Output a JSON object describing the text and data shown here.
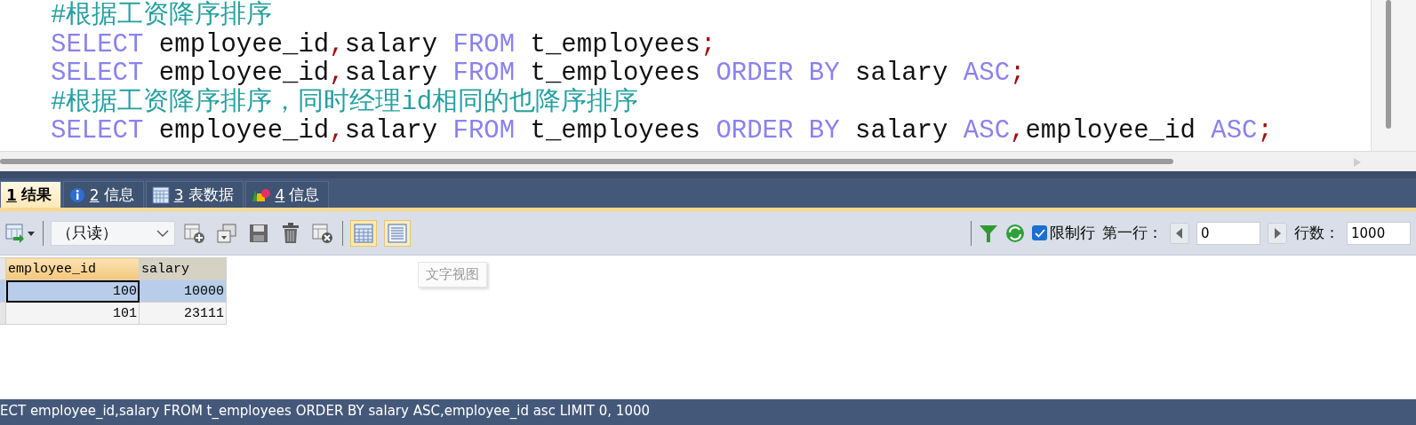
{
  "editor": {
    "lines": [
      [
        {
          "kind": "comment",
          "text": "#根据工资降序排序"
        }
      ],
      [
        {
          "kind": "keyword",
          "text": "SELECT"
        },
        {
          "kind": "plain",
          "text": " employee_id"
        },
        {
          "kind": "punct",
          "text": ","
        },
        {
          "kind": "plain",
          "text": "salary "
        },
        {
          "kind": "keyword",
          "text": "FROM"
        },
        {
          "kind": "plain",
          "text": " t_employees"
        },
        {
          "kind": "punct",
          "text": ";"
        }
      ],
      [
        {
          "kind": "keyword",
          "text": "SELECT"
        },
        {
          "kind": "plain",
          "text": " employee_id"
        },
        {
          "kind": "punct",
          "text": ","
        },
        {
          "kind": "plain",
          "text": "salary "
        },
        {
          "kind": "keyword",
          "text": "FROM"
        },
        {
          "kind": "plain",
          "text": " t_employees "
        },
        {
          "kind": "keyword",
          "text": "ORDER BY"
        },
        {
          "kind": "plain",
          "text": " salary "
        },
        {
          "kind": "keyword",
          "text": "ASC"
        },
        {
          "kind": "punct",
          "text": ";"
        }
      ],
      [
        {
          "kind": "comment",
          "text": "#根据工资降序排序，同时经理id相同的也降序排序"
        }
      ],
      [
        {
          "kind": "keyword",
          "text": "SELECT"
        },
        {
          "kind": "plain",
          "text": " employee_id"
        },
        {
          "kind": "punct",
          "text": ","
        },
        {
          "kind": "plain",
          "text": "salary "
        },
        {
          "kind": "keyword",
          "text": "FROM"
        },
        {
          "kind": "plain",
          "text": " t_employees "
        },
        {
          "kind": "keyword",
          "text": "ORDER BY"
        },
        {
          "kind": "plain",
          "text": " salary "
        },
        {
          "kind": "keyword",
          "text": "ASC"
        },
        {
          "kind": "punct",
          "text": ","
        },
        {
          "kind": "plain",
          "text": "employee_id "
        },
        {
          "kind": "keyword",
          "text": "ASC"
        },
        {
          "kind": "punct",
          "text": ";"
        }
      ]
    ]
  },
  "tabs": [
    {
      "number": "1",
      "label": "结果",
      "selected": true
    },
    {
      "number": "2",
      "label": "信息",
      "selected": false
    },
    {
      "number": "3",
      "label": "表数据",
      "selected": false
    },
    {
      "number": "4",
      "label": "信息",
      "selected": false
    }
  ],
  "toolbar": {
    "mode": "（只读）",
    "limit_rows": {
      "label": "限制行",
      "checked": true
    },
    "first_row_label": "第一行：",
    "first_row": "0",
    "row_count_label": "行数：",
    "row_count": "1000",
    "views": [
      {
        "kind": "grid",
        "selected": true
      },
      {
        "kind": "text",
        "selected": false
      }
    ],
    "tooltip": "文字视图"
  },
  "grid": {
    "columns": [
      {
        "name": "employee_id",
        "selected": true
      },
      {
        "name": "salary",
        "selected": false
      }
    ],
    "rows": [
      {
        "cells": [
          "100",
          "10000"
        ],
        "selected": true
      },
      {
        "cells": [
          "101",
          "23111"
        ],
        "selected": false
      }
    ]
  },
  "status_bar": "ECT employee_id,salary FROM t_employees ORDER BY salary ASC,employee_id asc LIMIT 0, 1000"
}
